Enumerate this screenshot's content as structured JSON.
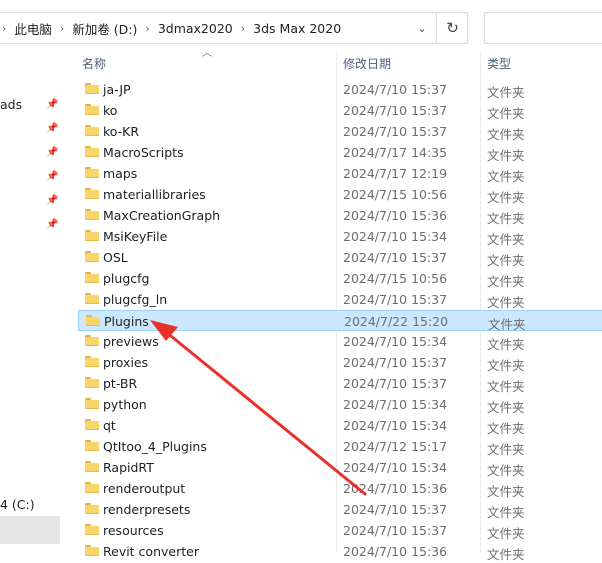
{
  "address": {
    "crumbs": [
      "此电脑",
      "新加卷 (D:)",
      "3dmax2020",
      "3ds Max 2020"
    ]
  },
  "nav": {
    "quick_access_partial": "ads",
    "drive_partial": "4 (C:)"
  },
  "columns": {
    "name": "名称",
    "date": "修改日期",
    "type": "类型"
  },
  "rows": [
    {
      "name": "ja-JP",
      "date": "2024/7/10 15:37",
      "type": "文件夹"
    },
    {
      "name": "ko",
      "date": "2024/7/10 15:37",
      "type": "文件夹"
    },
    {
      "name": "ko-KR",
      "date": "2024/7/10 15:37",
      "type": "文件夹"
    },
    {
      "name": "MacroScripts",
      "date": "2024/7/17 14:35",
      "type": "文件夹"
    },
    {
      "name": "maps",
      "date": "2024/7/17 12:19",
      "type": "文件夹"
    },
    {
      "name": "materiallibraries",
      "date": "2024/7/15 10:56",
      "type": "文件夹"
    },
    {
      "name": "MaxCreationGraph",
      "date": "2024/7/10 15:36",
      "type": "文件夹"
    },
    {
      "name": "MsiKeyFile",
      "date": "2024/7/10 15:34",
      "type": "文件夹"
    },
    {
      "name": "OSL",
      "date": "2024/7/10 15:37",
      "type": "文件夹"
    },
    {
      "name": "plugcfg",
      "date": "2024/7/15 10:56",
      "type": "文件夹"
    },
    {
      "name": "plugcfg_ln",
      "date": "2024/7/10 15:37",
      "type": "文件夹"
    },
    {
      "name": "Plugins",
      "date": "2024/7/22 15:20",
      "type": "文件夹"
    },
    {
      "name": "previews",
      "date": "2024/7/10 15:34",
      "type": "文件夹"
    },
    {
      "name": "proxies",
      "date": "2024/7/10 15:37",
      "type": "文件夹"
    },
    {
      "name": "pt-BR",
      "date": "2024/7/10 15:37",
      "type": "文件夹"
    },
    {
      "name": "python",
      "date": "2024/7/10 15:34",
      "type": "文件夹"
    },
    {
      "name": "qt",
      "date": "2024/7/10 15:34",
      "type": "文件夹"
    },
    {
      "name": "QtItoo_4_Plugins",
      "date": "2024/7/12 15:17",
      "type": "文件夹"
    },
    {
      "name": "RapidRT",
      "date": "2024/7/10 15:34",
      "type": "文件夹"
    },
    {
      "name": "renderoutput",
      "date": "2024/7/10 15:36",
      "type": "文件夹"
    },
    {
      "name": "renderpresets",
      "date": "2024/7/10 15:37",
      "type": "文件夹"
    },
    {
      "name": "resources",
      "date": "2024/7/10 15:37",
      "type": "文件夹"
    },
    {
      "name": "Revit converter",
      "date": "2024/7/10 15:36",
      "type": "文件夹"
    }
  ],
  "selected_index": 11,
  "colors": {
    "selection_bg": "#cce8ff",
    "selection_border": "#99d1ff",
    "annotation": "#e8312b",
    "folder": "#f7d56b"
  },
  "icons": {
    "folder": "folder-icon",
    "pin": "pin-icon",
    "refresh": "refresh-icon",
    "dropdown": "chevron-down-icon"
  }
}
